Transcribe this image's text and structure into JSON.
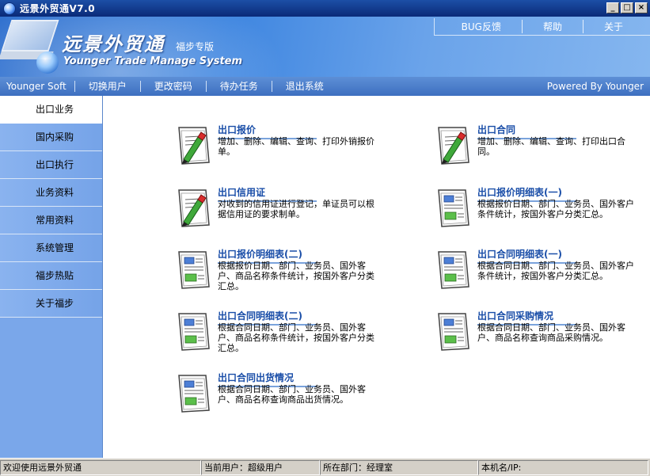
{
  "window": {
    "title": "远景外贸通V7.0",
    "controls": {
      "minimize": "_",
      "maximize": "□",
      "close": "×"
    }
  },
  "banner": {
    "brand_main": "远景外贸通",
    "brand_sub": "福步专版",
    "brand_en": "Younger Trade Manage System",
    "links": [
      "BUG反馈",
      "帮助",
      "关于"
    ]
  },
  "menubar": {
    "items": [
      "Younger Soft",
      "切换用户",
      "更改密码",
      "待办任务",
      "退出系统"
    ],
    "right": "Powered By Younger"
  },
  "sidebar": {
    "items": [
      {
        "label": "出口业务",
        "active": true
      },
      {
        "label": "国内采购",
        "active": false
      },
      {
        "label": "出口执行",
        "active": false
      },
      {
        "label": "业务资料",
        "active": false
      },
      {
        "label": "常用资料",
        "active": false
      },
      {
        "label": "系统管理",
        "active": false
      },
      {
        "label": "福步热贴",
        "active": false
      },
      {
        "label": "关于福步",
        "active": false
      }
    ]
  },
  "tiles": [
    {
      "title": "出口报价",
      "desc": "增加、删除、编辑、查询、打印外销报价单。",
      "icon": "edit-document-icon"
    },
    {
      "title": "出口合同",
      "desc": "增加、删除、编辑、查询、打印出口合同。",
      "icon": "edit-document-icon"
    },
    {
      "title": "出口信用证",
      "desc": "对收到的信用证进行登记，单证员可以根据信用证的要求制单。",
      "icon": "edit-document-icon"
    },
    {
      "title": "出口报价明细表(一)",
      "desc": "根据报价日期、部门、业务员、国外客户条件统计，按国外客户分类汇总。",
      "icon": "report-document-icon"
    },
    {
      "title": "出口报价明细表(二)",
      "desc": "根据报价日期、部门、业务员、国外客户、商品名称条件统计，按国外客户分类汇总。",
      "icon": "report-document-icon"
    },
    {
      "title": "出口合同明细表(一)",
      "desc": "根据合同日期、部门、业务员、国外客户条件统计，按国外客户分类汇总。",
      "icon": "report-document-icon"
    },
    {
      "title": "出口合同明细表(二)",
      "desc": "根据合同日期、部门、业务员、国外客户、商品名称条件统计，按国外客户分类汇总。",
      "icon": "report-document-icon"
    },
    {
      "title": "出口合同采购情况",
      "desc": "根据合同日期、部门、业务员、国外客户、商品名称查询商品采购情况。",
      "icon": "report-document-icon"
    },
    {
      "title": "出口合同出货情况",
      "desc": "根据合同日期、部门、业务员、国外客户、商品名称查询商品出货情况。",
      "icon": "report-document-icon"
    }
  ],
  "statusbar": {
    "welcome": "欢迎使用远景外贸通",
    "user": "当前用户：超级用户",
    "dept": "所在部门：经理室",
    "host": "本机名/IP:",
    "extra": ""
  },
  "colors": {
    "titlebar": "#0a2a78",
    "banner": "#3f86e0",
    "menubar": "#3d6fc0",
    "sidebar": "#7aa7ea",
    "tile_title": "#1a4ea8"
  }
}
